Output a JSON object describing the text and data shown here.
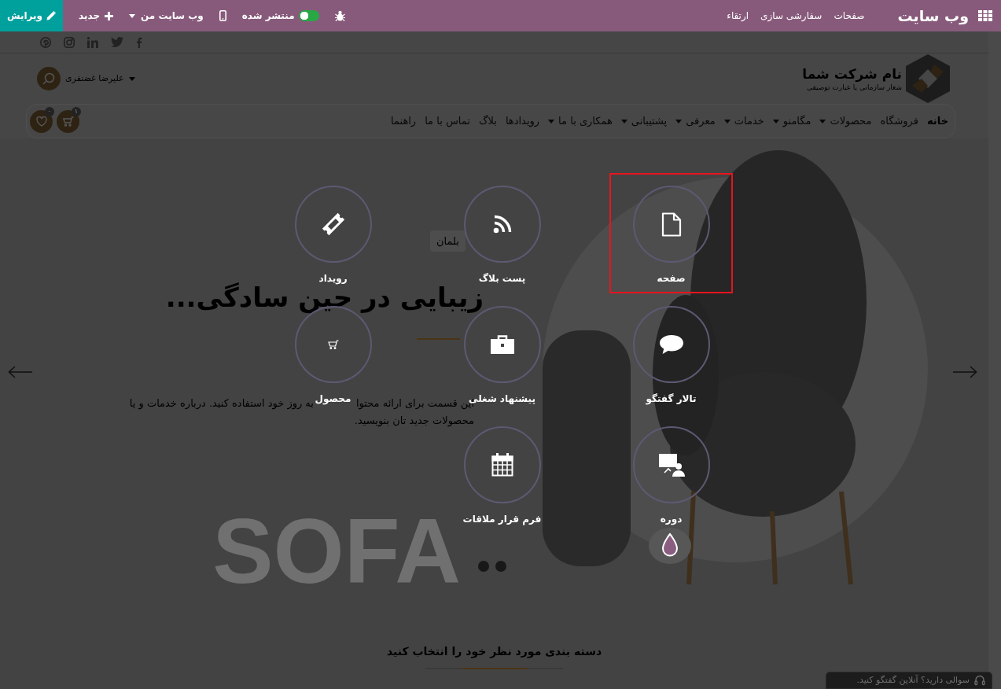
{
  "top_bar": {
    "title": "وب سایت",
    "menu": [
      {
        "label": "صفحات"
      },
      {
        "label": "سفارشی سازی"
      },
      {
        "label": "ارتقاء"
      }
    ],
    "publish": {
      "label": "منتشر شده",
      "on": true
    },
    "website_menu": {
      "label": "وب سایت من"
    },
    "new_button": {
      "label": "جدید"
    },
    "edit_button": {
      "label": "ویرایش"
    }
  },
  "header": {
    "company_name": "نام شرکت شما",
    "tagline": "شعار سازمانی یا عبارت توصیفی",
    "user_name": "علیرضا غضنفری"
  },
  "nav": {
    "items": [
      {
        "label": "خانه",
        "selected": true,
        "dropdown": false
      },
      {
        "label": "فروشگاه",
        "selected": false,
        "dropdown": false
      },
      {
        "label": "محصولات",
        "selected": false,
        "dropdown": true
      },
      {
        "label": "مگامنو",
        "selected": false,
        "dropdown": true
      },
      {
        "label": "خدمات",
        "selected": false,
        "dropdown": true
      },
      {
        "label": "معرفی",
        "selected": false,
        "dropdown": true
      },
      {
        "label": "پشتیبانی",
        "selected": false,
        "dropdown": true
      },
      {
        "label": "همکاری با ما",
        "selected": false,
        "dropdown": true
      },
      {
        "label": "رویدادها",
        "selected": false,
        "dropdown": false
      },
      {
        "label": "بلاگ",
        "selected": false,
        "dropdown": false
      },
      {
        "label": "تماس با ما",
        "selected": false,
        "dropdown": false
      },
      {
        "label": "راهنما",
        "selected": false,
        "dropdown": false
      }
    ],
    "cart_count": "۱",
    "wishlist_count": "۰"
  },
  "hero": {
    "tag": "بلمان",
    "headline": "زیبایی در حین سادگی...",
    "paragraph_lines": [
      {
        "segments": [
          "این قسمت برای ارائه محتوا",
          "به روز خود استفاده کنید. درباره خدمات و یا"
        ]
      },
      {
        "segments": [
          "محصولات جدید تان بنویسید."
        ]
      }
    ],
    "big_text": "SOFA"
  },
  "new_content": {
    "items": [
      {
        "kind": "page",
        "label": "صفحه",
        "highlighted": true
      },
      {
        "kind": "blog",
        "label": "پست بلاگ",
        "highlighted": false
      },
      {
        "kind": "event",
        "label": "رویداد",
        "highlighted": false
      },
      {
        "kind": "forum",
        "label": "تالار گفتگو",
        "highlighted": false
      },
      {
        "kind": "job",
        "label": "پیشنهاد شغلی",
        "highlighted": false
      },
      {
        "kind": "product",
        "label": "محصول",
        "highlighted": false
      },
      {
        "kind": "course",
        "label": "دوره",
        "highlighted": false
      },
      {
        "kind": "appointment",
        "label": "فرم قرار ملاقات",
        "highlighted": false
      }
    ]
  },
  "section": {
    "title": "دسته بندی مورد نظر خود را انتخاب کنید"
  },
  "chat_button": {
    "label": "سوالی دارید؟ آنلاین گفتگو کنید."
  }
}
